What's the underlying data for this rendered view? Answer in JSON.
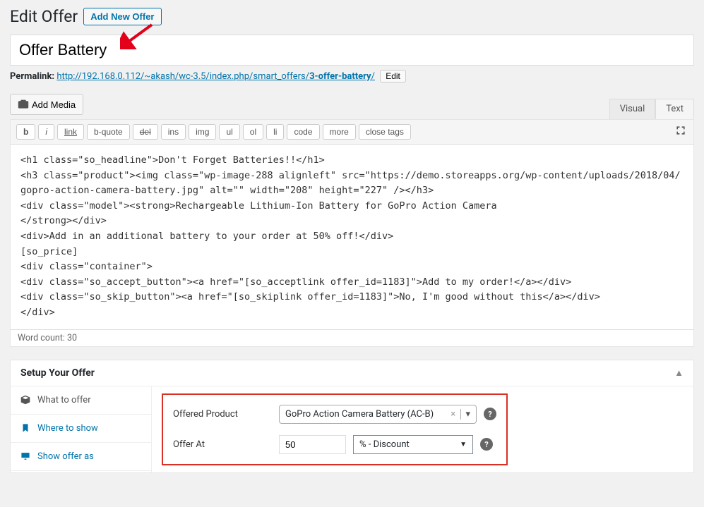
{
  "header": {
    "title": "Edit Offer",
    "add_new": "Add New Offer"
  },
  "post_title": "Offer Battery",
  "permalink": {
    "label": "Permalink:",
    "base": "http://192.168.0.112/~akash/wc-3.5/index.php/smart_offers/",
    "slug": "3-offer-battery",
    "edit": "Edit"
  },
  "media": {
    "add_media": "Add Media"
  },
  "editor_tabs": {
    "visual": "Visual",
    "text": "Text"
  },
  "toolbar": [
    "b",
    "i",
    "link",
    "b-quote",
    "del",
    "ins",
    "img",
    "ul",
    "ol",
    "li",
    "code",
    "more",
    "close tags"
  ],
  "editor_content": "<h1 class=\"so_headline\">Don't Forget Batteries!!</h1>\n<h3 class=\"product\"><img class=\"wp-image-288 alignleft\" src=\"https://demo.storeapps.org/wp-content/uploads/2018/04/gopro-action-camera-battery.jpg\" alt=\"\" width=\"208\" height=\"227\" /></h3>\n<div class=\"model\"><strong>Rechargeable Lithium-Ion Battery for GoPro Action Camera\n</strong></div>\n<div>Add in an additional battery to your order at 50% off!</div>\n[so_price]\n<div class=\"container\">\n<div class=\"so_accept_button\"><a href=\"[so_acceptlink offer_id=1183]\">Add to my order!</a></div>\n<div class=\"so_skip_button\"><a href=\"[so_skiplink offer_id=1183]\">No, I'm good without this</a></div>\n</div>",
  "word_count_label": "Word count: ",
  "word_count": "30",
  "setup": {
    "title": "Setup Your Offer",
    "nav": {
      "what": "What to offer",
      "where": "Where to show",
      "show_as": "Show offer as"
    },
    "form": {
      "offered_product_label": "Offered Product",
      "offered_product_value": "GoPro Action Camera Battery (AC-B)",
      "offer_at_label": "Offer At",
      "offer_at_value": "50",
      "discount_type": "% - Discount"
    }
  }
}
